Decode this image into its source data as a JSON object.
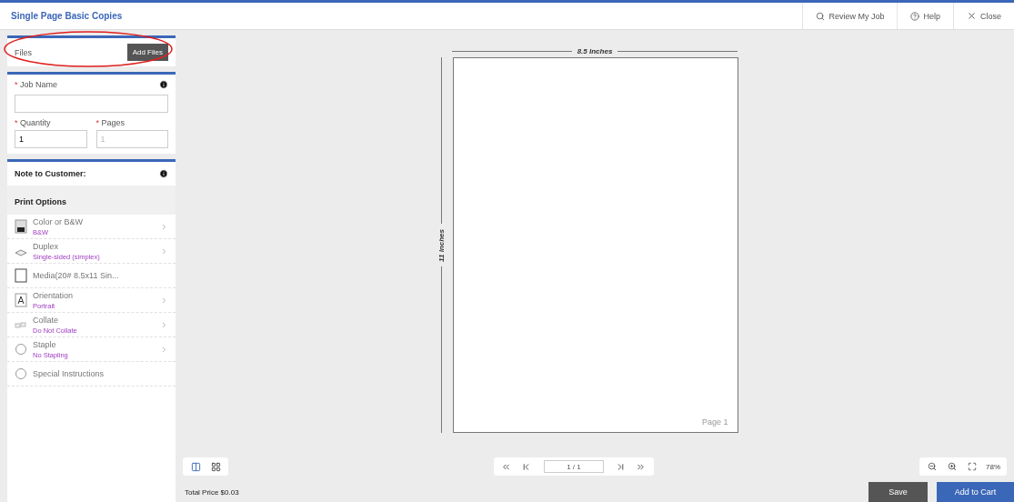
{
  "header": {
    "title": "Single Page Basic Copies",
    "actions": [
      {
        "label": "Review My Job",
        "kind": "search"
      },
      {
        "label": "Help",
        "kind": "help"
      },
      {
        "label": "Close",
        "kind": "close"
      }
    ]
  },
  "files": {
    "label": "Files",
    "button": "Add Files"
  },
  "job": {
    "required_mark": "*",
    "name_label": "Job Name",
    "quantity_label": "Quantity",
    "quantity_value": "1",
    "pages_label": "Pages",
    "pages_value": "1"
  },
  "note_label": "Note to Customer:",
  "print_options": {
    "title": "Print Options",
    "items": [
      {
        "kind": "option",
        "label": "Color or B&W",
        "value": "B&W"
      },
      {
        "kind": "option",
        "label": "Duplex",
        "value": "Single-sided (simplex)"
      },
      {
        "kind": "plain",
        "label": "Media(20# 8.5x11 Sin..."
      },
      {
        "kind": "option",
        "label": "Orientation",
        "value": "Portrait"
      },
      {
        "kind": "option",
        "label": "Collate",
        "value": "Do Not Collate"
      },
      {
        "kind": "option",
        "label": "Staple",
        "value": "No Stapling"
      },
      {
        "kind": "plain",
        "label": "Special Instructions"
      }
    ]
  },
  "preview": {
    "width_label": "8.5 Inches",
    "height_label": "11 Inches",
    "page_label": "Page 1"
  },
  "view_modes": [
    {
      "kind": "single",
      "selected": true
    },
    {
      "kind": "grid",
      "selected": false
    }
  ],
  "pager": {
    "value": "1 / 1"
  },
  "zoom": {
    "value": "78%"
  },
  "footer": {
    "total": "Total Price $0.03",
    "save": "Save",
    "add_to_cart": "Add to Cart"
  }
}
